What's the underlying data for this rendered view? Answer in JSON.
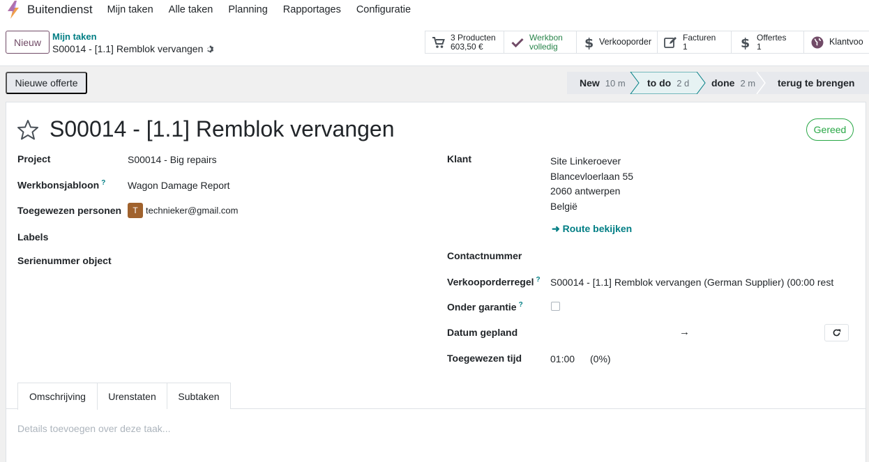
{
  "nav": {
    "app_name": "Buitendienst",
    "menu": [
      "Mijn taken",
      "Alle taken",
      "Planning",
      "Rapportages",
      "Configuratie"
    ]
  },
  "control_panel": {
    "new_label": "Nieuw",
    "breadcrumb_parent": "Mijn taken",
    "breadcrumb_current": "S00014 - [1.1] Remblok vervangen"
  },
  "smart_buttons": [
    {
      "icon": "cart-icon",
      "line1": "3 Producten",
      "line2": "603,50 €"
    },
    {
      "icon": "check-icon",
      "line1": "Werkbon",
      "line2": "volledig"
    },
    {
      "icon": "dollar-icon",
      "line1": "Verkooporder",
      "line2": ""
    },
    {
      "icon": "edit-icon",
      "line1": "Facturen",
      "line2": "1"
    },
    {
      "icon": "dollar-icon",
      "line1": "Offertes",
      "line2": "1"
    },
    {
      "icon": "globe-icon",
      "line1": "Klantvoo",
      "line2": ""
    }
  ],
  "status_bar": {
    "offer_button": "Nieuwe offerte",
    "stages": [
      {
        "name": "New",
        "duration": "10 m"
      },
      {
        "name": "to do",
        "duration": "2 d"
      },
      {
        "name": "done",
        "duration": "2 m"
      },
      {
        "name": "terug te brengen",
        "duration": ""
      }
    ],
    "active_stage": "to do"
  },
  "form": {
    "title": "S00014 - [1.1] Remblok vervangen",
    "state_badge": "Gereed",
    "left": {
      "project_label": "Project",
      "project_value": "S00014 - Big repairs",
      "template_label": "Werkbonsjabloon",
      "template_value": "Wagon Damage Report",
      "assignees_label": "Toegewezen personen",
      "assignee_initial": "T",
      "assignee_value": "technieker@gmail.com",
      "labels_label": "Labels",
      "serial_label": "Serienummer object"
    },
    "right": {
      "customer_label": "Klant",
      "customer_lines": [
        "Site Linkeroever",
        "Blancevloerlaan 55",
        "2060 antwerpen",
        "België"
      ],
      "route_link": "Route bekijken",
      "contact_label": "Contactnummer",
      "so_line_label": "Verkooporderregel",
      "so_line_value": "S00014 - [1.1] Remblok vervangen (German Supplier) (00:00 rest",
      "warranty_label": "Onder garantie",
      "planned_label": "Datum gepland",
      "planned_arrow": "→",
      "allocated_label": "Toegewezen tijd",
      "allocated_value": "01:00",
      "allocated_pct": "(0%)"
    },
    "help_mark": "?",
    "tabs": [
      "Omschrijving",
      "Urenstaten",
      "Subtaken"
    ],
    "active_tab": "Omschrijving",
    "description_placeholder": "Details toevoegen over deze taak..."
  },
  "colors": {
    "brand": "#714b67",
    "link": "#017e84",
    "success": "#28a745"
  }
}
